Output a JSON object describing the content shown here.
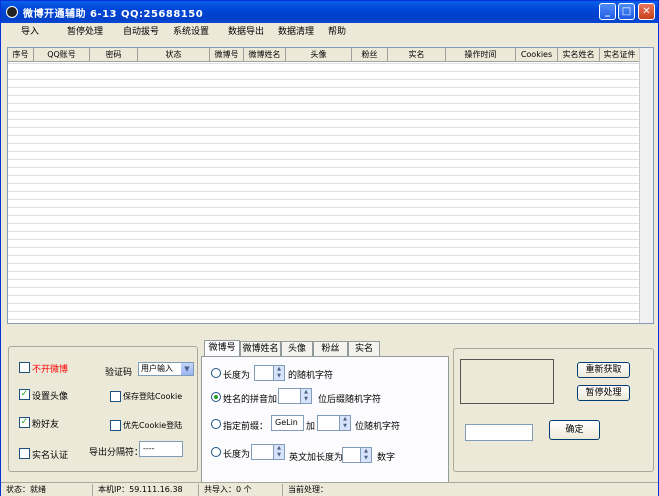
{
  "window": {
    "title": "微博开通辅助  6-13 QQ:25688150",
    "minimize": "_",
    "maximize": "□",
    "close": "✕"
  },
  "menu": [
    "导入",
    "暂停处理",
    "自动拔号",
    "系统设置",
    "数据导出",
    "数据清理",
    "帮助"
  ],
  "table": {
    "columns": [
      "序号",
      "QQ账号",
      "密码",
      "状态",
      "微博号",
      "微博姓名",
      "头像",
      "粉丝",
      "实名",
      "操作时间",
      "Cookies",
      "实名姓名",
      "实名证件"
    ]
  },
  "options": {
    "not_open_label": "不开微博",
    "set_avatar_label": "设置头像",
    "add_friends_label": "粉好友",
    "realname_label": "实名认证",
    "captcha_label": "验证码",
    "captcha_value": "用户输入",
    "save_cookie_label": "保存登陆Cookie",
    "prefer_cookie_label": "优先Cookie登陆",
    "export_sep_label": "导出分隔符：",
    "export_sep_value": "----"
  },
  "tabs": [
    "微博号",
    "微博姓名",
    "头像",
    "粉丝",
    "实名"
  ],
  "weibo_tab": {
    "opt1_prefix": "长度为",
    "opt1_suffix": "的随机字符",
    "opt2_prefix": "姓名的拼音加",
    "opt2_suffix": "位后缀随机字符",
    "opt3_prefix": "指定前缀：",
    "opt3_value": "GeLin",
    "opt3_mid": "加",
    "opt3_suffix": "位随机字符",
    "opt4_prefix": "长度为",
    "opt4_mid": "英文加长度为",
    "opt4_suffix": "数字"
  },
  "right": {
    "refresh": "重新获取",
    "pause": "暂停处理",
    "confirm": "确定"
  },
  "status": {
    "state": "状态：就绪",
    "ip": "本机IP：59.111.16.38",
    "imported": "共导入：0 个",
    "current": "当前处理："
  },
  "colors": {
    "title_bar": "#0a5fe8",
    "window_bg": "#ece9d8",
    "warning_text": "#ff0000"
  }
}
